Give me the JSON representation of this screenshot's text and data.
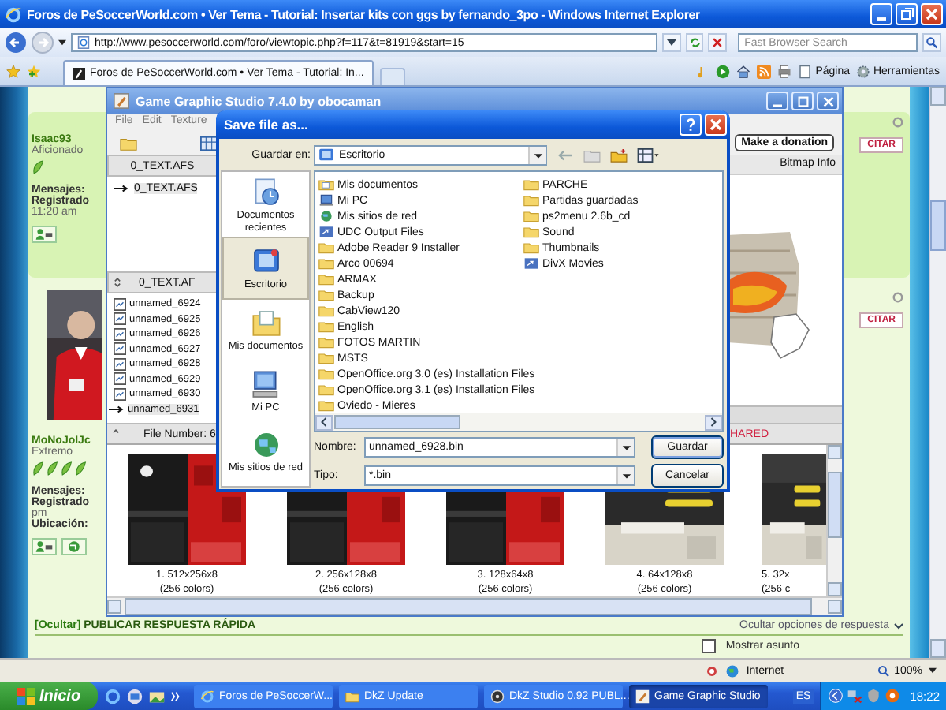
{
  "browser": {
    "title": "Foros de PeSoccerWorld.com • Ver Tema - Tutorial: Insertar kits con ggs by fernando_3po - Windows Internet Explorer",
    "address": "http://www.pesoccerworld.com/foro/viewtopic.php?f=117&t=81919&start=15",
    "search_placeholder": "Fast Browser Search",
    "tab": "Foros de PeSoccerWorld.com • Ver Tema - Tutorial: In...",
    "commands": [
      "Página",
      "Herramientas"
    ],
    "status_zone": "Internet",
    "zoom": "100%"
  },
  "forum": {
    "posts": [
      {
        "user": "Isaac93",
        "rank": "Aficionado",
        "badges": [
          {
            "kind": "leaf"
          }
        ],
        "details": [
          {
            "text": "Mensajes:",
            "kind": "label"
          },
          {
            "text": "Registrado",
            "kind": "label"
          },
          {
            "text": "11:20 am",
            "kind": "value"
          }
        ],
        "contacts": [
          {
            "kind": "profile"
          }
        ],
        "quote": "CITAR"
      },
      {
        "user": "MoNoJoIJc",
        "rank": "Extremo",
        "badges": [
          {
            "kind": "leaf"
          },
          {
            "kind": "leaf"
          },
          {
            "kind": "leaf"
          },
          {
            "kind": "leaf"
          }
        ],
        "avatar": {
          "kind": "picture"
        },
        "details": [
          {
            "text": "Mensajes:",
            "kind": "label"
          },
          {
            "text": "Registrado",
            "kind": "label"
          },
          {
            "text": "pm",
            "kind": "value"
          },
          {
            "text": "Ubicación:",
            "kind": "label"
          }
        ],
        "contacts": [
          {
            "kind": "profile"
          },
          {
            "kind": "web"
          }
        ],
        "quote": "CITAR"
      }
    ],
    "quick_reply": {
      "toggle": "[Ocultar]",
      "title": "PUBLICAR RESPUESTA RÁPIDA",
      "options": "Ocultar opciones de respuesta"
    },
    "show_subject": {
      "label": "Mostrar asunto",
      "checked": false
    }
  },
  "ggs": {
    "title": "Game Graphic Studio 7.4.0 by obocaman",
    "menu": [
      "File",
      "Edit",
      "Texture"
    ],
    "donate": "Make a donation",
    "panel_tab": "Bitmap Info",
    "tree_header": "0_TEXT.AFS",
    "tree": [
      {
        "label": "0_TEXT.AFS",
        "selected": true
      }
    ],
    "list_header": "0_TEXT.AF",
    "files": [
      {
        "label": "unnamed_6924",
        "selected": false
      },
      {
        "label": "unnamed_6925",
        "selected": false
      },
      {
        "label": "unnamed_6926",
        "selected": false
      },
      {
        "label": "unnamed_6927",
        "selected": false
      },
      {
        "label": "unnamed_6928",
        "selected": false
      },
      {
        "label": "unnamed_6929",
        "selected": false
      },
      {
        "label": "unnamed_6930",
        "selected": false
      },
      {
        "label": "unnamed_6931",
        "selected": true
      }
    ],
    "file_number": "File Number: 6",
    "shared": "HARED",
    "thumbnails": [
      {
        "caption": "1. 512x256x8",
        "colors": "(256 colors)",
        "kind": "picture"
      },
      {
        "caption": "2. 256x128x8",
        "colors": "(256 colors)",
        "kind": "picture"
      },
      {
        "caption": "3. 128x64x8",
        "colors": "(256 colors)",
        "kind": "picture"
      },
      {
        "caption": "4. 64x128x8",
        "colors": "(256 colors)",
        "kind": "picture"
      },
      {
        "caption": "5. 32x",
        "colors": "(256 c",
        "kind": "picture"
      }
    ]
  },
  "dialog": {
    "title": "Save file as...",
    "look_in_label": "Guardar en:",
    "look_in": "Escritorio",
    "places": [
      {
        "label": "Documentos recientes",
        "kind": "recent",
        "selected": false
      },
      {
        "label": "Escritorio",
        "kind": "desktop",
        "selected": true
      },
      {
        "label": "Mis documentos",
        "kind": "documents",
        "selected": false
      },
      {
        "label": "Mi PC",
        "kind": "computer",
        "selected": false
      },
      {
        "label": "Mis sitios de red",
        "kind": "network",
        "selected": false
      }
    ],
    "files": [
      {
        "label": "Mis documentos",
        "kind": "documents"
      },
      {
        "label": "Mi PC",
        "kind": "computer"
      },
      {
        "label": "Mis sitios de red",
        "kind": "network"
      },
      {
        "label": "UDC Output Files",
        "kind": "shortcut"
      },
      {
        "label": "Adobe Reader 9 Installer",
        "kind": "folder"
      },
      {
        "label": "Arco 00694",
        "kind": "folder"
      },
      {
        "label": "ARMAX",
        "kind": "folder"
      },
      {
        "label": "Backup",
        "kind": "folder"
      },
      {
        "label": "CabView120",
        "kind": "folder"
      },
      {
        "label": "English",
        "kind": "folder"
      },
      {
        "label": "FOTOS MARTIN",
        "kind": "folder"
      },
      {
        "label": "MSTS",
        "kind": "folder"
      },
      {
        "label": "OpenOffice.org 3.0 (es) Installation Files",
        "kind": "folder"
      },
      {
        "label": "OpenOffice.org 3.1 (es) Installation Files",
        "kind": "folder"
      },
      {
        "label": "Oviedo - Mieres",
        "kind": "folder"
      },
      {
        "label": "PARCHE",
        "kind": "folder"
      },
      {
        "label": "Partidas guardadas",
        "kind": "folder"
      },
      {
        "label": "ps2menu 2.6b_cd",
        "kind": "folder"
      },
      {
        "label": "Sound",
        "kind": "folder"
      },
      {
        "label": "Thumbnails",
        "kind": "folder"
      },
      {
        "label": "DivX Movies",
        "kind": "shortcut"
      }
    ],
    "name_label": "Nombre:",
    "name": "unnamed_6928.bin",
    "type_label": "Tipo:",
    "type": "*.bin",
    "buttons": [
      "Guardar",
      "Cancelar"
    ]
  },
  "taskbar": {
    "start": "Inicio",
    "tasks": [
      {
        "label": "Foros de PeSoccerW...",
        "kind": "browser",
        "selected": false
      },
      {
        "label": "DkZ Update",
        "kind": "folder",
        "selected": false
      },
      {
        "label": "DkZ Studio 0.92 PUBL...",
        "kind": "app",
        "selected": false
      },
      {
        "label": "Game Graphic Studio",
        "kind": "pencil",
        "selected": true
      }
    ],
    "language": "ES",
    "clock": "18:22"
  }
}
